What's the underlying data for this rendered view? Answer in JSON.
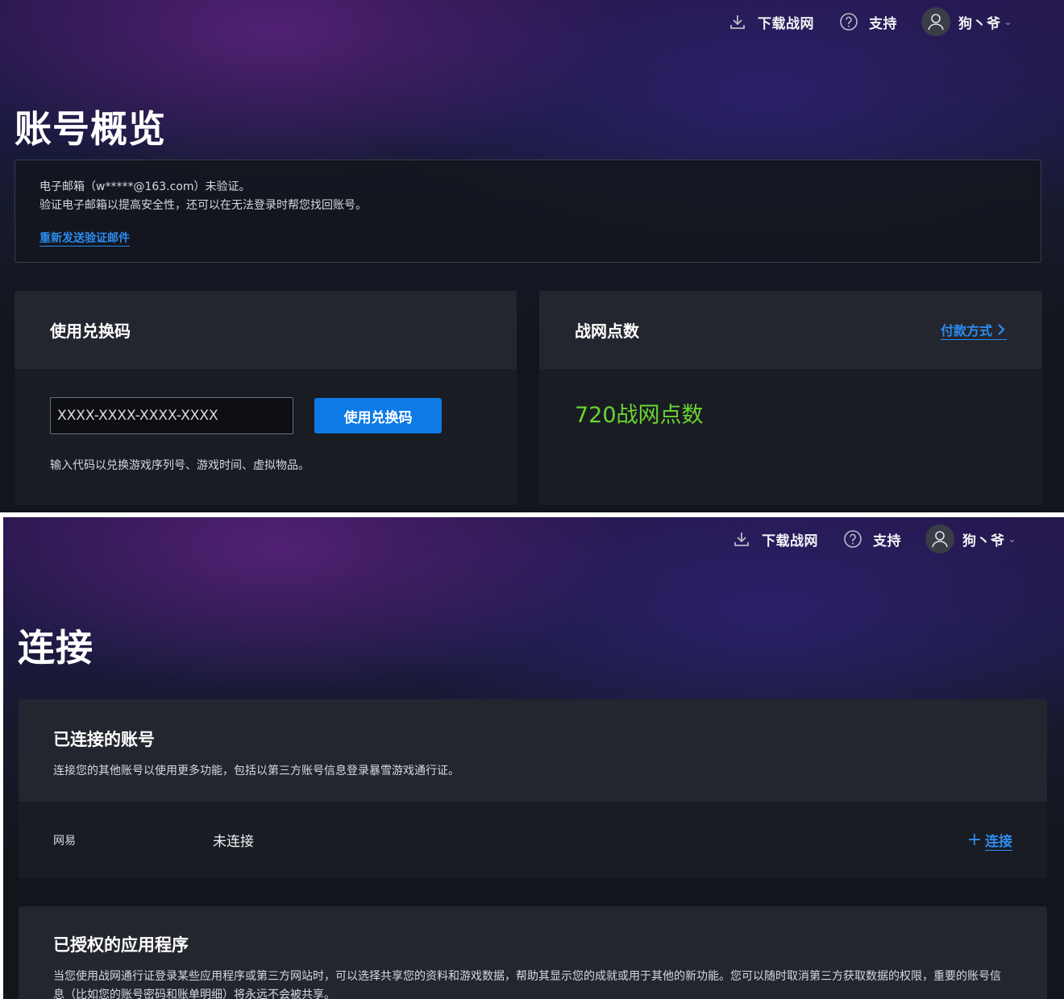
{
  "topbar": {
    "download_label": "下载战网",
    "support_label": "支持",
    "user_name": "狗丶爷",
    "caret": "⌄"
  },
  "overview": {
    "title": "账号概览",
    "email_notice": {
      "line1": "电子邮箱（w*****@163.com）未验证。",
      "line2": "验证电子邮箱以提高安全性，还可以在无法登录时帮您找回账号。",
      "resend_link": "重新发送验证邮件"
    },
    "redeem": {
      "title": "使用兑换码",
      "placeholder": "XXXX-XXXX-XXXX-XXXX",
      "button": "使用兑换码",
      "hint": "输入代码以兑换游戏序列号、游戏时间、虚拟物品。"
    },
    "points": {
      "title": "战网点数",
      "payment_link": "付款方式",
      "value": "720战网点数"
    }
  },
  "connections": {
    "title": "连接",
    "connected_accounts": {
      "title": "已连接的账号",
      "description": "连接您的其他账号以使用更多功能，包括以第三方账号信息登录暴雪游戏通行证。",
      "rows": [
        {
          "name": "网易",
          "status": "未连接",
          "action": "连接",
          "action_prefix": "+"
        }
      ]
    },
    "authorized_apps": {
      "title": "已授权的应用程序",
      "description": "当您使用战网通行证登录某些应用程序或第三方网站时，可以选择共享您的资料和游戏数据，帮助其显示您的成就或用于其他的新功能。您可以随时取消第三方获取数据的权限，重要的账号信息（比如您的账号密码和账单明细）将永远不会被共享。"
    }
  },
  "colors": {
    "accent_blue": "#2d8cf0",
    "button_blue": "#0e7ae6",
    "points_green": "#6ad52e"
  }
}
